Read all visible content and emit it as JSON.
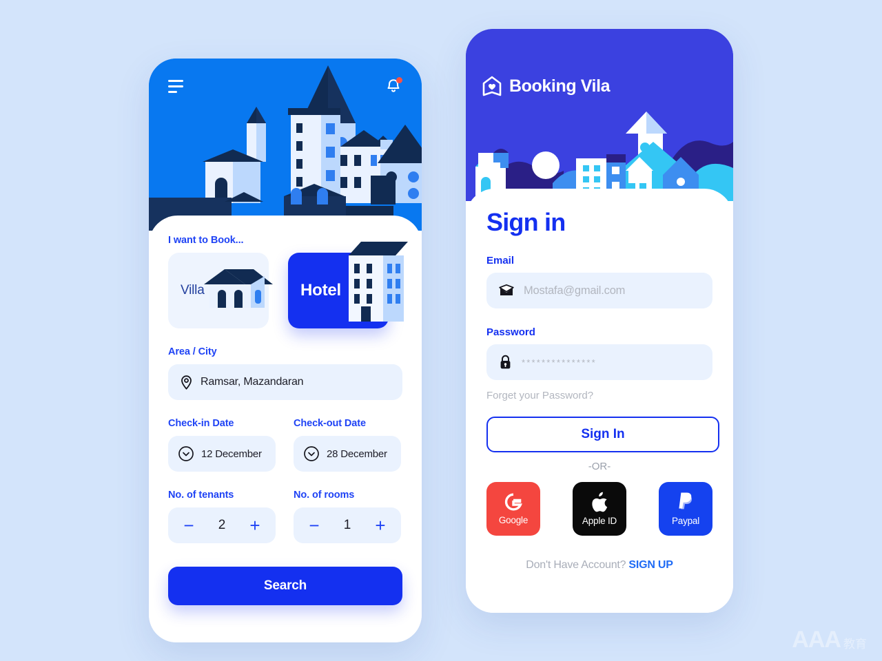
{
  "canvas": {
    "background_color": "#d3e4fb"
  },
  "booking_screen": {
    "hero": {
      "background_color": "#0878f0",
      "menu_icon": "hamburger-icon",
      "notification_icon": "bell-icon",
      "notification_dot_color": "#fc5242",
      "illustration": "city-skyline-illustration"
    },
    "book_type": {
      "label": "I want to Book...",
      "options": [
        {
          "label": "Villa",
          "selected": false,
          "icon": "villa-house-icon"
        },
        {
          "label": "Hotel",
          "selected": true,
          "icon": "hotel-building-icon"
        }
      ]
    },
    "area": {
      "label": "Area / City",
      "icon": "location-pin-icon",
      "value": "Ramsar, Mazandaran"
    },
    "checkin": {
      "label": "Check-in Date",
      "icon": "chevron-down-circle-icon",
      "value": "12 December"
    },
    "checkout": {
      "label": "Check-out Date",
      "icon": "chevron-down-circle-icon",
      "value": "28 December"
    },
    "tenants": {
      "label": "No. of tenants",
      "minus": "−",
      "value": "2",
      "plus": "+"
    },
    "rooms": {
      "label": "No. of rooms",
      "minus": "−",
      "value": "1",
      "plus": "+"
    },
    "search_button": {
      "label": "Search",
      "color": "#1430f0"
    }
  },
  "signin_screen": {
    "hero": {
      "background_color": "#3b41e0",
      "logo_icon": "house-heart-logo-icon",
      "brand_name": "Booking Vila",
      "illustration": "city-skyline-illustration"
    },
    "title": "Sign in",
    "email": {
      "label": "Email",
      "icon": "envelope-icon",
      "placeholder": "Mostafa@gmail.com",
      "value": ""
    },
    "password": {
      "label": "Password",
      "icon": "lock-icon",
      "masked_value": "***************"
    },
    "forgot_link": "Forget your Password?",
    "signin_button": {
      "label": "Sign In",
      "color": "#1430f0"
    },
    "or_divider": "-OR-",
    "social": [
      {
        "label": "Google",
        "icon": "google-g-icon",
        "color": "#f4463f"
      },
      {
        "label": "Apple ID",
        "icon": "apple-icon",
        "color": "#0a0a0a"
      },
      {
        "label": "Paypal",
        "icon": "paypal-icon",
        "color": "#1542ef"
      }
    ],
    "signup_prompt": "Don't Have Account?",
    "signup_link": "SIGN UP"
  },
  "watermark": {
    "primary": "AAA",
    "secondary": "教育"
  }
}
